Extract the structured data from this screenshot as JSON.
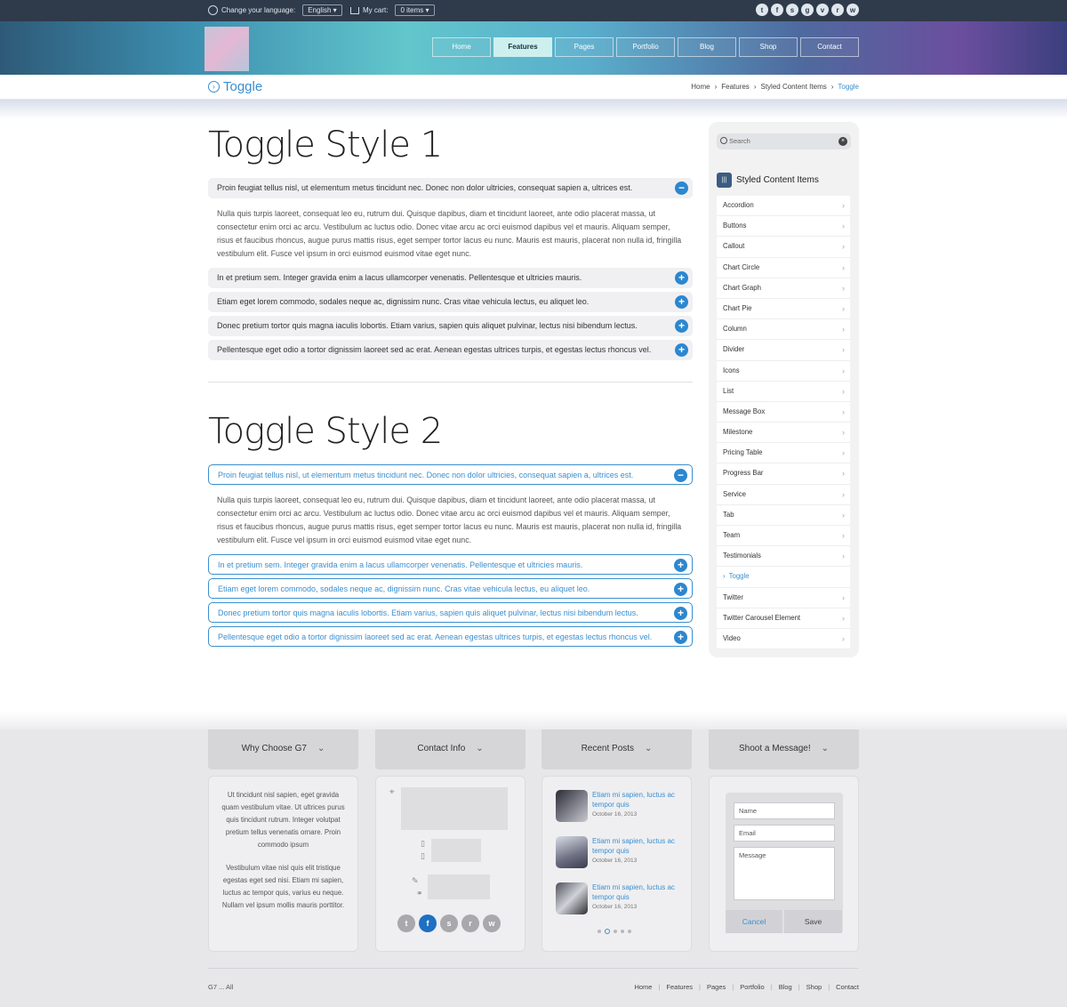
{
  "topbar": {
    "language_label": "Change your language:",
    "language_value": "English",
    "cart_label": "My cart:",
    "cart_value": "0 items",
    "social_icons": [
      "twitter-icon",
      "facebook-icon",
      "skype-icon",
      "google-plus-icon",
      "vimeo-icon",
      "rss-icon",
      "wordpress-icon"
    ]
  },
  "nav": [
    "Home",
    "Features",
    "Pages",
    "Portfolio",
    "Blog",
    "Shop",
    "Contact"
  ],
  "nav_active": "Features",
  "page": {
    "title": "Toggle"
  },
  "breadcrumb": [
    "Home",
    "Features",
    "Styled Content Items",
    "Toggle"
  ],
  "style1": {
    "heading": "Toggle Style 1",
    "open_title": "Proin feugiat tellus nisl, ut elementum metus tincidunt nec. Donec non dolor ultricies, consequat sapien a, ultrices est.",
    "open_body": "Nulla quis turpis laoreet, consequat leo eu, rutrum dui. Quisque dapibus, diam et tincidunt laoreet, ante odio placerat massa, ut consectetur enim orci ac arcu. Vestibulum ac luctus odio. Donec vitae arcu ac orci euismod dapibus vel et mauris. Aliquam semper, risus et faucibus rhoncus, augue purus mattis risus, eget semper tortor lacus eu nunc. Mauris est mauris, placerat non nulla id, fringilla vestibulum elit. Fusce vel ipsum in orci euismod euismod vitae eget nunc.",
    "closed": [
      "In et pretium sem. Integer gravida enim a lacus ullamcorper venenatis. Pellentesque et ultricies mauris.",
      "Etiam eget lorem commodo, sodales neque ac, dignissim nunc. Cras vitae vehicula lectus, eu aliquet leo.",
      "Donec pretium tortor quis magna iaculis lobortis. Etiam varius, sapien quis aliquet pulvinar, lectus nisi bibendum lectus.",
      "Pellentesque eget odio a tortor dignissim laoreet sed ac erat. Aenean egestas ultrices turpis, et egestas lectus rhoncus vel."
    ]
  },
  "style2": {
    "heading": "Toggle Style 2",
    "open_title": "Proin feugiat tellus nisl, ut elementum metus tincidunt nec. Donec non dolor ultricies, consequat sapien a, ultrices est.",
    "open_body": "Nulla quis turpis laoreet, consequat leo eu, rutrum dui. Quisque dapibus, diam et tincidunt laoreet, ante odio placerat massa, ut consectetur enim orci ac arcu. Vestibulum ac luctus odio. Donec vitae arcu ac orci euismod dapibus vel et mauris. Aliquam semper, risus et faucibus rhoncus, augue purus mattis risus, eget semper tortor lacus eu nunc. Mauris est mauris, placerat non nulla id, fringilla vestibulum elit. Fusce vel ipsum in orci euismod euismod vitae eget nunc.",
    "closed": [
      "In et pretium sem. Integer gravida enim a lacus ullamcorper venenatis. Pellentesque et ultricies mauris.",
      "Etiam eget lorem commodo, sodales neque ac, dignissim nunc. Cras vitae vehicula lectus, eu aliquet leo.",
      "Donec pretium tortor quis magna iaculis lobortis. Etiam varius, sapien quis aliquet pulvinar, lectus nisi bibendum lectus.",
      "Pellentesque eget odio a tortor dignissim laoreet sed ac erat. Aenean egestas ultrices turpis, et egestas lectus rhoncus vel."
    ]
  },
  "sidebar": {
    "search_placeholder": "Search",
    "heading": "Styled Content Items",
    "items": [
      "Accordion",
      "Buttons",
      "Callout",
      "Chart Circle",
      "Chart Graph",
      "Chart Pie",
      "Column",
      "Divider",
      "Icons",
      "List",
      "Message Box",
      "Milestone",
      "Pricing Table",
      "Progress Bar",
      "Service",
      "Tab",
      "Team",
      "Testimonials",
      "Toggle",
      "Twitter",
      "Twitter Carousel Element",
      "Video"
    ],
    "active": "Toggle"
  },
  "footer": {
    "headers": [
      "Why Choose G7",
      "Contact Info",
      "Recent Posts",
      "Shoot a Message!"
    ],
    "why": [
      "Ut tincidunt nisl sapien, eget gravida quam vestibulum vitae. Ut ultrices purus quis tincidunt rutrum. Integer volutpat pretium tellus venenatis ornare. Proin commodo ipsum",
      "Vestibulum vitae nisl quis elit tristique egestas eget sed nisi. Etiam mi sapien, luctus ac tempor quis, varius eu neque. Nullam vel ipsum mollis mauris porttitor."
    ],
    "posts": [
      {
        "title": "Etiam mi sapien, luctus ac tempor quis",
        "date": "October 16, 2013"
      },
      {
        "title": "Etiam mi sapien, luctus ac tempor quis",
        "date": "October 16, 2013"
      },
      {
        "title": "Etiam mi sapien, luctus ac tempor quis",
        "date": "October 16, 2013"
      }
    ],
    "form": {
      "name": "Name",
      "email": "Email",
      "message": "Message",
      "cancel": "Cancel",
      "save": "Save"
    },
    "copyright": "G7 ... All"
  },
  "footer_nav": [
    "Home",
    "Features",
    "Pages",
    "Portfolio",
    "Blog",
    "Shop",
    "Contact"
  ],
  "colors": {
    "accent": "#3a8fd0",
    "nav_active": "#cdf0ee"
  }
}
